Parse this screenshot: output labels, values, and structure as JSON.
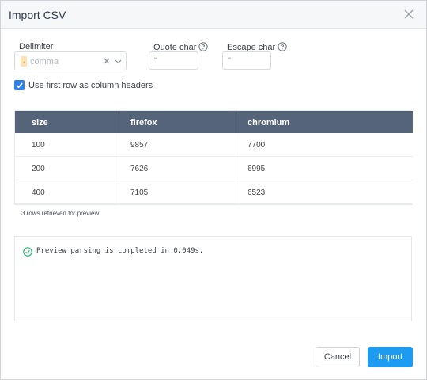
{
  "dialog": {
    "title": "Import CSV",
    "close_icon": "close-icon"
  },
  "options": {
    "delimiter_label": "Delimiter",
    "delimiter_chip": ",",
    "delimiter_value": "comma",
    "quote_label": "Quote char",
    "quote_value": "\"",
    "escape_label": "Escape char",
    "escape_value": "\"",
    "help_icon": "question-circle-icon",
    "first_row_header_label": "Use first row as column headers",
    "first_row_header_checked": true
  },
  "table": {
    "headers": [
      "size",
      "firefox",
      "chromium"
    ],
    "rows": [
      [
        "100",
        "9857",
        "7700"
      ],
      [
        "200",
        "7626",
        "6995"
      ],
      [
        "400",
        "7105",
        "6523"
      ]
    ],
    "rows_note": "3 rows retrieved for preview"
  },
  "log": {
    "icon": "check-circle-icon",
    "message": "Preview parsing is completed in 0.049s."
  },
  "footer": {
    "cancel_label": "Cancel",
    "import_label": "Import"
  },
  "colors": {
    "accent": "#1d9bf0",
    "table_header_bg": "#56647a",
    "success": "#2eb872",
    "checkbox": "#2f80ed"
  }
}
